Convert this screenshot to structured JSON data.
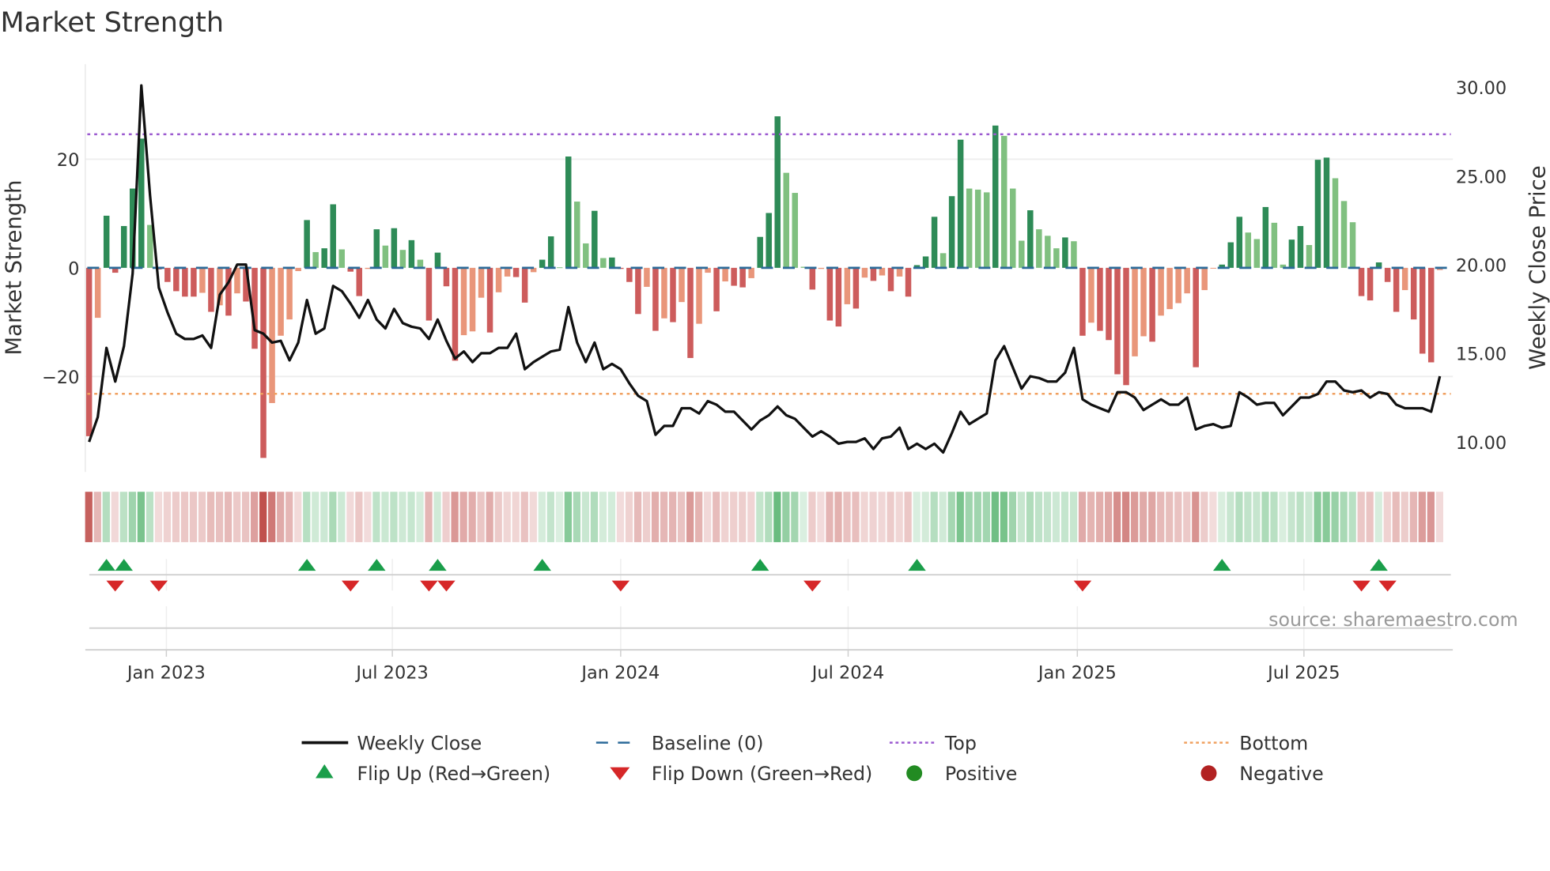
{
  "title": "Market Strength",
  "source": "source: sharemaestro.com",
  "colors": {
    "pos_strong": "#2e8b57",
    "pos_weak": "#80c080",
    "neg_strong": "#cd5c5c",
    "neg_weak": "#e9967a",
    "baseline": "#2b6a99",
    "top": "#9b59d0",
    "bottom": "#f0a060",
    "price": "#111111",
    "flip_up": "#1a9e4a",
    "flip_down": "#d62728",
    "positive": "#228b22",
    "negative": "#b22222"
  },
  "chart_data": {
    "type": "bar+line",
    "title": "Market Strength",
    "ylabel": "Market Strength",
    "y2label": "Weekly Close Price",
    "ylim": [
      -37.6,
      37.5
    ],
    "y2lim": [
      8.3,
      31.3
    ],
    "yticks": [
      {
        "v": 20,
        "label": "20"
      },
      {
        "v": 0,
        "label": "0"
      },
      {
        "v": -20,
        "label": "−20"
      }
    ],
    "y2ticks": [
      {
        "v": 30,
        "label": "30.00"
      },
      {
        "v": 25,
        "label": "25.00"
      },
      {
        "v": 20,
        "label": "20.00"
      },
      {
        "v": 15,
        "label": "15.00"
      },
      {
        "v": 10,
        "label": "10.00"
      }
    ],
    "xticks": [
      {
        "label": "Jan 2023",
        "week": 8.87
      },
      {
        "label": "Jul 2023",
        "week": 34.8
      },
      {
        "label": "Jan 2024",
        "week": 61.0
      },
      {
        "label": "Jul 2024",
        "week": 87.1
      },
      {
        "label": "Jan 2025",
        "week": 113.4
      },
      {
        "label": "Jul 2025",
        "week": 139.4
      }
    ],
    "top_level": 24.6,
    "bottom_level": -23.2,
    "baseline": 0,
    "strength": [
      -31.0,
      -9.2,
      9.6,
      -0.9,
      7.7,
      14.6,
      23.8,
      7.9,
      -0.3,
      -2.6,
      -4.3,
      -5.3,
      -5.3,
      -4.6,
      -8.1,
      -6.9,
      -8.8,
      -4.7,
      -6.2,
      -14.9,
      -35.0,
      -24.9,
      -12.5,
      -9.5,
      -0.6,
      8.8,
      2.9,
      3.6,
      11.7,
      3.4,
      -0.7,
      -5.2,
      -0.2,
      7.1,
      4.1,
      7.3,
      3.3,
      5.1,
      1.5,
      -9.7,
      2.8,
      -3.4,
      -17.1,
      -12.4,
      -11.7,
      -5.5,
      -11.9,
      -4.5,
      -1.6,
      -1.7,
      -6.4,
      -0.8,
      1.5,
      5.8,
      0.1,
      20.5,
      12.2,
      4.5,
      10.5,
      1.8,
      1.9,
      -0.2,
      -2.6,
      -8.5,
      -3.5,
      -11.6,
      -9.3,
      -10.0,
      -6.3,
      -16.6,
      -10.3,
      -0.9,
      -8.0,
      -2.5,
      -3.3,
      -3.6,
      -1.9,
      5.7,
      10.1,
      27.9,
      17.5,
      13.8,
      0.2,
      -4.0,
      -0.2,
      -9.7,
      -10.8,
      -6.7,
      -7.5,
      -1.8,
      -2.4,
      -1.4,
      -4.3,
      -1.6,
      -5.3,
      0.5,
      2.1,
      9.4,
      2.7,
      13.2,
      23.6,
      14.6,
      14.4,
      13.9,
      26.2,
      24.3,
      14.6,
      5.0,
      10.6,
      7.1,
      5.9,
      3.6,
      5.6,
      4.9,
      -12.5,
      -10.1,
      -11.6,
      -13.3,
      -19.6,
      -21.6,
      -16.3,
      -12.6,
      -13.6,
      -8.8,
      -7.6,
      -6.5,
      -4.7,
      -18.3,
      -4.1,
      -0.1,
      0.6,
      4.7,
      9.4,
      6.5,
      5.3,
      11.2,
      8.3,
      0.6,
      5.2,
      7.7,
      4.2,
      19.9,
      20.3,
      16.5,
      12.3,
      8.4,
      -5.2,
      -6.0,
      1.0,
      -2.6,
      -8.1,
      -4.1,
      -9.5,
      -15.8,
      -17.4,
      -0.4
    ],
    "weekly_close": [
      10.0,
      11.4,
      15.3,
      13.4,
      15.4,
      19.5,
      30.1,
      23.9,
      18.7,
      17.3,
      16.1,
      15.8,
      15.8,
      16.0,
      15.3,
      18.3,
      19.0,
      20.0,
      20.0,
      16.3,
      16.1,
      15.6,
      15.7,
      14.6,
      15.6,
      18.0,
      16.1,
      16.4,
      18.8,
      18.5,
      17.8,
      17.0,
      18.0,
      16.9,
      16.4,
      17.5,
      16.7,
      16.5,
      16.4,
      15.8,
      16.9,
      15.7,
      14.7,
      15.1,
      14.5,
      15.0,
      15.0,
      15.3,
      15.3,
      16.1,
      14.1,
      14.5,
      14.8,
      15.1,
      15.2,
      17.6,
      15.6,
      14.5,
      15.6,
      14.1,
      14.4,
      14.1,
      13.3,
      12.6,
      12.3,
      10.4,
      10.9,
      10.9,
      11.9,
      11.9,
      11.6,
      12.3,
      12.1,
      11.7,
      11.7,
      11.2,
      10.7,
      11.2,
      11.5,
      12.0,
      11.5,
      11.3,
      10.8,
      10.3,
      10.6,
      10.3,
      9.9,
      10.0,
      10.0,
      10.2,
      9.6,
      10.2,
      10.3,
      10.8,
      9.6,
      9.9,
      9.6,
      9.9,
      9.4,
      10.5,
      11.7,
      11.0,
      11.3,
      11.6,
      14.6,
      15.4,
      14.2,
      13.0,
      13.7,
      13.6,
      13.4,
      13.4,
      13.9,
      15.3,
      12.4,
      12.1,
      11.9,
      11.7,
      12.8,
      12.8,
      12.5,
      11.8,
      12.1,
      12.4,
      12.1,
      12.1,
      12.5,
      10.7,
      10.9,
      11.0,
      10.8,
      10.9,
      12.8,
      12.5,
      12.1,
      12.2,
      12.2,
      11.5,
      12.0,
      12.5,
      12.5,
      12.7,
      13.4,
      13.4,
      12.9,
      12.8,
      12.9,
      12.5,
      12.8,
      12.7,
      12.1,
      11.9,
      11.9,
      11.9,
      11.7,
      13.7
    ],
    "legend": {
      "placement": "bottom",
      "entries": [
        {
          "key": "weekly_close",
          "label": "Weekly Close"
        },
        {
          "key": "baseline",
          "label": "Baseline (0)"
        },
        {
          "key": "top",
          "label": "Top"
        },
        {
          "key": "bottom",
          "label": "Bottom"
        },
        {
          "key": "flip_up",
          "label": "Flip Up (Red→Green)"
        },
        {
          "key": "flip_down",
          "label": "Flip Down (Green→Red)"
        },
        {
          "key": "positive",
          "label": "Positive"
        },
        {
          "key": "negative",
          "label": "Negative"
        }
      ]
    }
  }
}
